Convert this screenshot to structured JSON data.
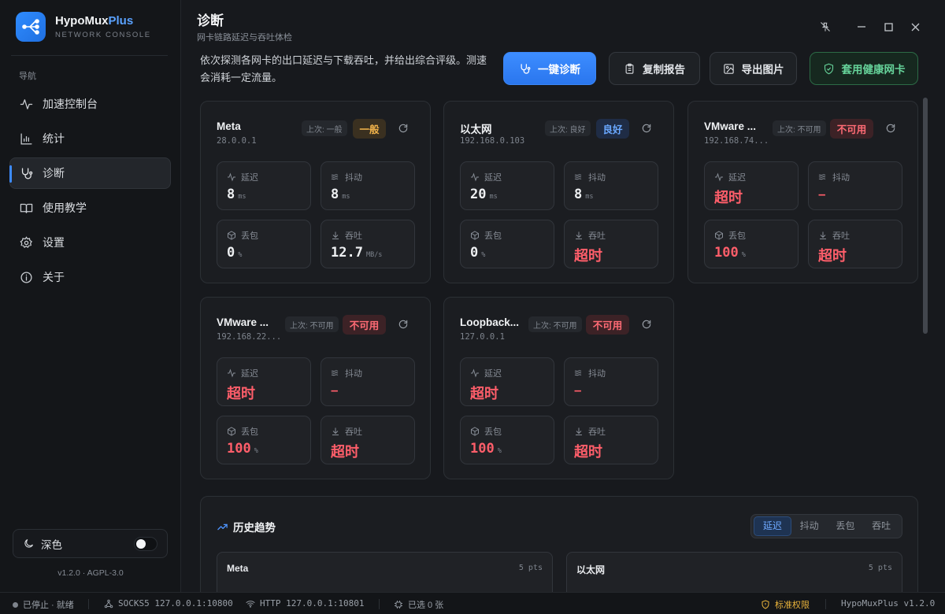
{
  "app": {
    "brand_main": "HypoMux",
    "brand_plus": "Plus",
    "brand_sub": "NETWORK CONSOLE",
    "version": "v1.2.0 · AGPL-3.0"
  },
  "sidebar": {
    "nav_title": "导航",
    "items": [
      {
        "label": "加速控制台",
        "icon": "pulse-icon"
      },
      {
        "label": "统计",
        "icon": "bar-chart-icon"
      },
      {
        "label": "诊断",
        "icon": "stethoscope-icon",
        "active": true
      },
      {
        "label": "使用教学",
        "icon": "book-icon"
      },
      {
        "label": "设置",
        "icon": "gear-icon"
      },
      {
        "label": "关于",
        "icon": "info-icon"
      }
    ],
    "theme_label": "深色"
  },
  "header": {
    "title": "诊断",
    "subtitle": "网卡链路延迟与吞吐体检",
    "description": "依次探测各网卡的出口延迟与下载吞吐，并给出综合评级。测速会消耗一定流量。"
  },
  "actions": {
    "diagnose": "一键诊断",
    "copy_report": "复制报告",
    "export_image": "导出图片",
    "apply_healthy": "套用健康网卡"
  },
  "metric_labels": {
    "latency": "延迟",
    "jitter": "抖动",
    "loss": "丢包",
    "throughput": "吞吐"
  },
  "cards": [
    {
      "name": "Meta",
      "ip": "28.0.0.1",
      "last": "上次: 一般",
      "grade": "一般",
      "latency": "8",
      "latency_unit": "ms",
      "jitter": "8",
      "jitter_unit": "ms",
      "loss": "0",
      "loss_unit": "%",
      "throughput": "12.7",
      "throughput_unit": "MB/s"
    },
    {
      "name": "以太网",
      "ip": "192.168.0.103",
      "last": "上次: 良好",
      "grade": "良好",
      "latency": "20",
      "latency_unit": "ms",
      "jitter": "8",
      "jitter_unit": "ms",
      "loss": "0",
      "loss_unit": "%",
      "throughput": "超时"
    },
    {
      "name": "VMware ...",
      "ip": "192.168.74...",
      "last": "上次: 不可用",
      "grade": "不可用",
      "latency": "超时",
      "jitter": "–",
      "loss": "100",
      "loss_unit": "%",
      "throughput": "超时"
    },
    {
      "name": "VMware ...",
      "ip": "192.168.22...",
      "last": "上次: 不可用",
      "grade": "不可用",
      "latency": "超时",
      "jitter": "–",
      "loss": "100",
      "loss_unit": "%",
      "throughput": "超时"
    },
    {
      "name": "Loopback...",
      "ip": "127.0.0.1",
      "last": "上次: 不可用",
      "grade": "不可用",
      "latency": "超时",
      "jitter": "–",
      "loss": "100",
      "loss_unit": "%",
      "throughput": "超时"
    }
  ],
  "history": {
    "title": "历史趋势",
    "tabs": [
      "延迟",
      "抖动",
      "丢包",
      "吞吐"
    ],
    "active_tab": "延迟",
    "items": [
      {
        "name": "Meta",
        "pts": "5 pts"
      },
      {
        "name": "以太网",
        "pts": "5 pts"
      }
    ]
  },
  "statusbar": {
    "state": "已停止 · 就绪",
    "socks": "SOCKS5 127.0.0.1:10800",
    "http": "HTTP 127.0.0.1:10801",
    "selected": "已选 0 张",
    "permission": "标准权限",
    "version": "HypoMuxPlus v1.2.0"
  },
  "colors": {
    "accent": "#3d8bff",
    "danger": "#ff5e6a",
    "warning": "#f0b24a",
    "success": "#66d39a"
  }
}
